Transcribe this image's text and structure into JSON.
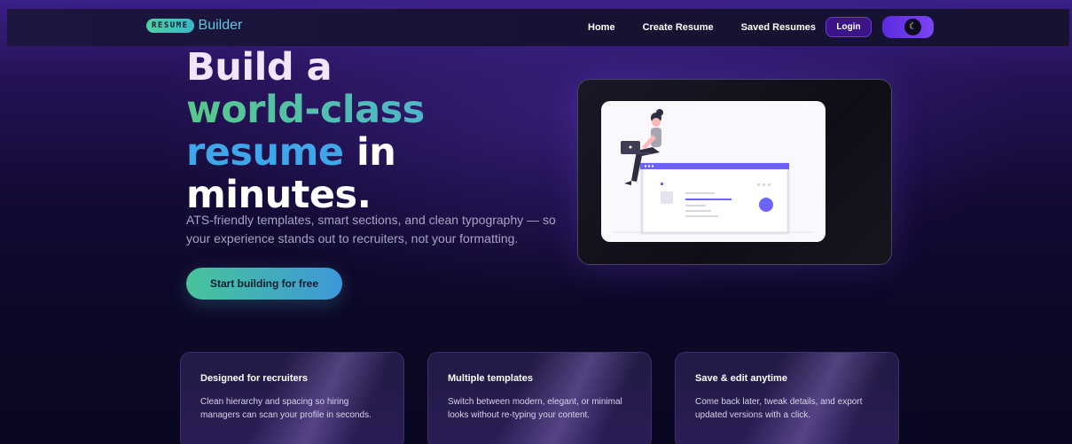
{
  "brand": {
    "badge": "RESUME",
    "name": "Builder"
  },
  "nav": {
    "links": [
      "Home",
      "Create Resume",
      "Saved Resumes"
    ],
    "login_label": "Login",
    "theme_icon": "moon-icon"
  },
  "hero": {
    "title_line1": "Build a",
    "title_line2": "world-class",
    "title_line3_a": "resume",
    "title_line3_b": " in",
    "title_line4": "minutes.",
    "subtitle": "ATS-friendly templates, smart sections, and clean typography — so your experience stands out to recruiters, not your formatting.",
    "cta_label": "Start building for free"
  },
  "illustration": {
    "icon": "woman-with-laptop-illustration"
  },
  "features": [
    {
      "title": "Designed for recruiters",
      "desc": "Clean hierarchy and spacing so hiring managers can scan your profile in seconds."
    },
    {
      "title": "Multiple templates",
      "desc": "Switch between modern, elegant, or minimal looks without re-typing your content."
    },
    {
      "title": "Save & edit anytime",
      "desc": "Come back later, tweak details, and export updated versions with a click."
    }
  ],
  "colors": {
    "accent": "#6b3be0",
    "cta_start": "#47c49b",
    "cta_end": "#3e98d9",
    "brand_text": "#5ec8e0"
  }
}
